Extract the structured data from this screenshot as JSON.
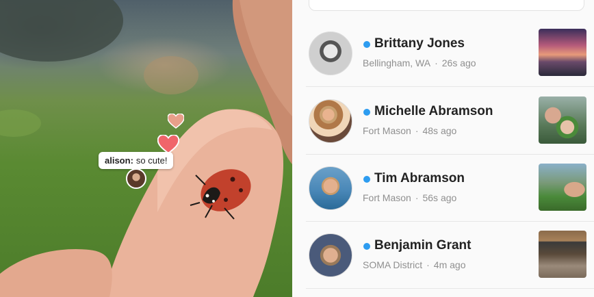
{
  "video": {
    "comment": {
      "user": "alison:",
      "text": "so cute!"
    }
  },
  "friends": [
    {
      "name": "Brittany Jones",
      "location": "Bellingham, WA",
      "time": "26s ago",
      "online": true
    },
    {
      "name": "Michelle Abramson",
      "location": "Fort Mason",
      "time": "48s ago",
      "online": true
    },
    {
      "name": "Tim Abramson",
      "location": "Fort Mason",
      "time": "56s ago",
      "online": true
    },
    {
      "name": "Benjamin Grant",
      "location": "SOMA District",
      "time": "4m ago",
      "online": true
    }
  ],
  "colors": {
    "online_dot": "#2d9cf0",
    "heart": "#f0656a",
    "heart_faded": "#e8a08a"
  },
  "icons": {
    "heart": "heart-icon",
    "online": "online-status-dot"
  }
}
